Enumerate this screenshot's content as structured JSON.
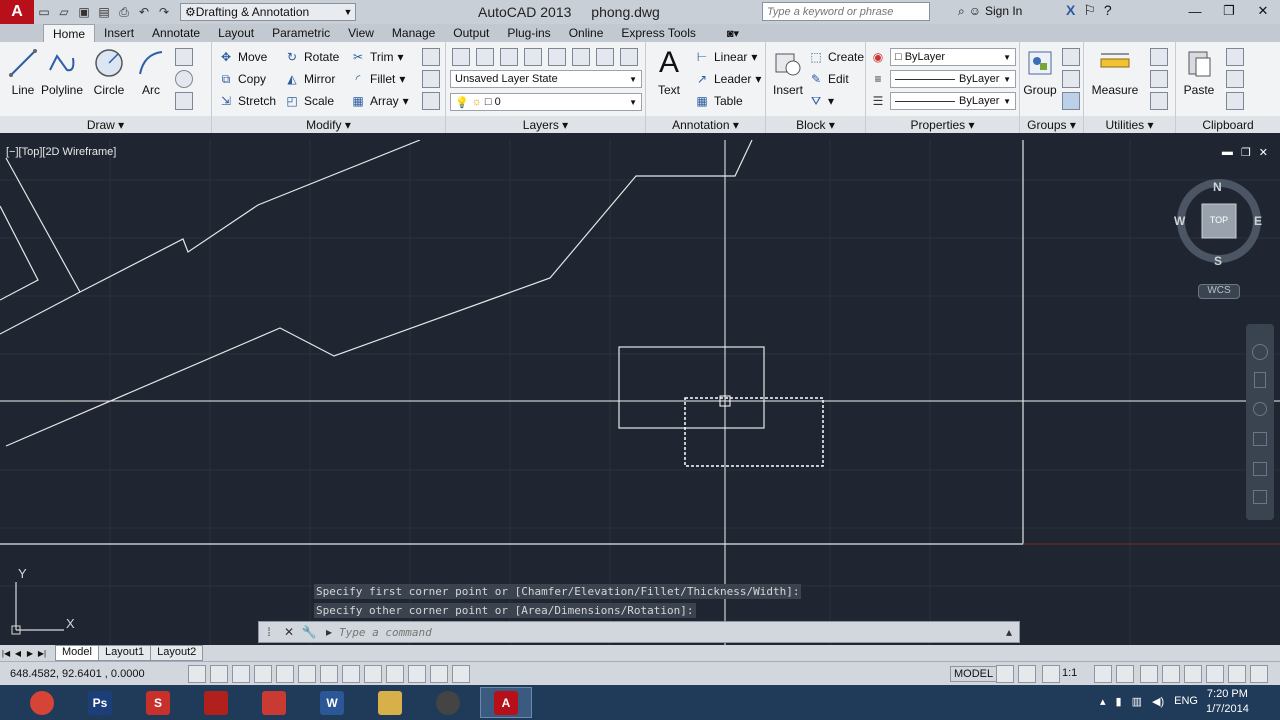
{
  "titlebar": {
    "workspace": "Drafting & Annotation",
    "app_name": "AutoCAD 2013",
    "file_name": "phong.dwg",
    "search_placeholder": "Type a keyword or phrase",
    "sign_in": "Sign In"
  },
  "tabs": [
    {
      "label": "Home"
    },
    {
      "label": "Insert"
    },
    {
      "label": "Annotate"
    },
    {
      "label": "Layout"
    },
    {
      "label": "Parametric"
    },
    {
      "label": "View"
    },
    {
      "label": "Manage"
    },
    {
      "label": "Output"
    },
    {
      "label": "Plug-ins"
    },
    {
      "label": "Online"
    },
    {
      "label": "Express Tools"
    }
  ],
  "ribbon": {
    "draw": {
      "title": "Draw",
      "line": "Line",
      "polyline": "Polyline",
      "circle": "Circle",
      "arc": "Arc"
    },
    "modify": {
      "title": "Modify",
      "move": "Move",
      "rotate": "Rotate",
      "trim": "Trim",
      "copy": "Copy",
      "mirror": "Mirror",
      "fillet": "Fillet",
      "stretch": "Stretch",
      "scale": "Scale",
      "array": "Array"
    },
    "layers": {
      "title": "Layers",
      "layer_state": "Unsaved Layer State",
      "current_layer": "0"
    },
    "annotation": {
      "title": "Annotation",
      "text": "Text",
      "linear": "Linear",
      "leader": "Leader",
      "table": "Table"
    },
    "block": {
      "title": "Block",
      "insert": "Insert",
      "create": "Create",
      "edit": "Edit"
    },
    "properties": {
      "title": "Properties",
      "color": "ByLayer",
      "linetype": "ByLayer",
      "lineweight": "ByLayer"
    },
    "groups": {
      "title": "Groups",
      "group": "Group"
    },
    "utilities": {
      "title": "Utilities",
      "measure": "Measure"
    },
    "clipboard": {
      "title": "Clipboard",
      "paste": "Paste"
    }
  },
  "viewport": {
    "label": "[−][Top][2D Wireframe]",
    "viewcube_top": "TOP",
    "compass": {
      "n": "N",
      "s": "S",
      "e": "E",
      "w": "W"
    },
    "wcs": "WCS"
  },
  "command": {
    "history": [
      "Specify first corner point or [Chamfer/Elevation/Fillet/Thickness/Width]:",
      "Specify other corner point or [Area/Dimensions/Rotation]:"
    ],
    "placeholder": "Type a command"
  },
  "ucs": {
    "x": "X",
    "y": "Y"
  },
  "layout_tabs": [
    {
      "label": "Model"
    },
    {
      "label": "Layout1"
    },
    {
      "label": "Layout2"
    }
  ],
  "status": {
    "coords": "648.4582, 92.6401 , 0.0000",
    "model": "MODEL",
    "scale": "1:1"
  },
  "taskbar": {
    "apps": [
      {
        "name": "Chrome",
        "color": "#d64437"
      },
      {
        "name": "Ps",
        "color": "#1c3f7a"
      },
      {
        "name": "S",
        "color": "#c7302b"
      },
      {
        "name": "Bag",
        "color": "#b0201d"
      },
      {
        "name": "Grid",
        "color": "#c93a33"
      },
      {
        "name": "W",
        "color": "#2b5797"
      },
      {
        "name": "Folder",
        "color": "#d8b04a"
      },
      {
        "name": "Film",
        "color": "#444444"
      },
      {
        "name": "A",
        "color": "#b8101a"
      }
    ],
    "language": "ENG",
    "time": "7:20 PM",
    "date": "1/7/2014"
  }
}
